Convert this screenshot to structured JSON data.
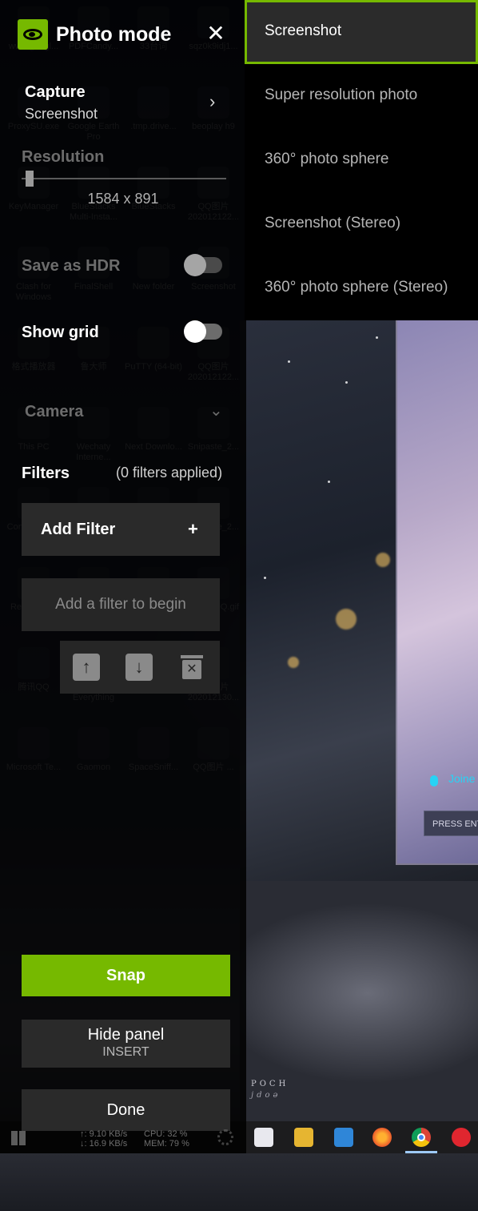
{
  "colors": {
    "accent": "#76b900",
    "panel_bg": "#000000"
  },
  "panel": {
    "title": "Photo mode",
    "close_glyph": "✕",
    "capture": {
      "label": "Capture",
      "value": "Screenshot",
      "chevron": "›"
    },
    "resolution": {
      "label": "Resolution",
      "value": "1584 x 891",
      "slider_level": 0.02
    },
    "save_as_hdr": {
      "label": "Save as HDR",
      "enabled": false,
      "disabled": true
    },
    "show_grid": {
      "label": "Show grid",
      "enabled": false
    },
    "camera": {
      "label": "Camera",
      "chevron": "⌄"
    },
    "filters": {
      "label": "Filters",
      "count_text": "(0 filters applied)"
    },
    "add_filter": {
      "label": "Add Filter",
      "plus": "+"
    },
    "filter_placeholder": "Add a filter to begin",
    "filter_tools": {
      "up_glyph": "↑",
      "down_glyph": "↓",
      "delete_glyph": "✕"
    },
    "snap_label": "Snap",
    "hide_panel": {
      "label": "Hide panel",
      "shortcut": "INSERT"
    },
    "done_label": "Done"
  },
  "capture_menu": {
    "options": [
      "Screenshot",
      "Super resolution photo",
      "360° photo sphere",
      "Screenshot (Stereo)",
      "360° photo sphere (Stereo)"
    ],
    "selected_index": 0
  },
  "background": {
    "voice_text": "Joine in cha",
    "press_text": "PRESS ENT",
    "epoch_text": "POCH",
    "epoch_text_2": "jdoǝ",
    "net_up": "↑: 9.10 KB/s",
    "net_down": "↓: 16.9 KB/s",
    "cpu_text": "CPU: 32 %",
    "mem_text": "MEM: 79 %",
    "desktop_icons": [
      "www.googl...",
      "PDFCandy...",
      "33台词",
      "sqz0k9idj1...",
      "ProxySU.exe",
      "Google Earth Pro",
      ".tmp.drive...",
      "beoplay h9",
      "KeyManager",
      "BlueStacks Multi-Insta...",
      "BlueStacks",
      "QQ图片 202012122...",
      "Clash for Windows",
      "FinalShell",
      "New folder",
      "Screenshot",
      "格式播放器",
      "鲁大师",
      "PuTTY (64-bit)",
      "QQ图片 202012122...",
      "This PC",
      "Wechaty Interne...",
      "Next Downlo...",
      "Snipaste_2...",
      "Control Panel",
      "Telegram",
      "Motrix",
      "Snipaste_2...",
      "Recycle Bin",
      "WeChat",
      "迅雷",
      "2q9kj4OQ.gif",
      "腾讯QQ",
      "Search Everything",
      "µTorrent",
      "QQ图片 202012130...",
      "Microsoft Te...",
      "Gaomon",
      "SpaceSniff...",
      "QQ图片 ..."
    ]
  }
}
